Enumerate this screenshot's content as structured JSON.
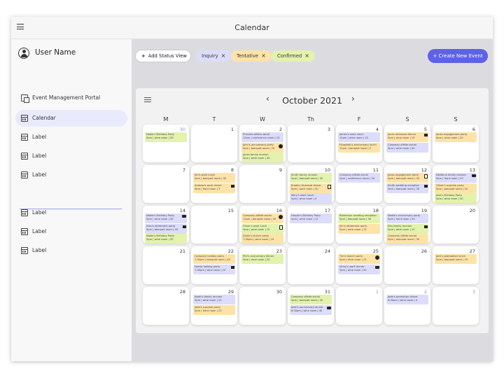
{
  "app": {
    "title": "Calendar"
  },
  "sidebar": {
    "user_name": "User Name",
    "items": [
      {
        "label": "Event Management Portal",
        "icon": "portal-icon"
      },
      {
        "label": "Calendar",
        "icon": "calendar-icon",
        "active": true
      },
      {
        "label": "Label",
        "icon": "calendar-icon"
      },
      {
        "label": "Label",
        "icon": "calendar-icon"
      },
      {
        "label": "Label",
        "icon": "calendar-icon"
      },
      {
        "label": "Label",
        "icon": "calendar-icon"
      },
      {
        "label": "Label",
        "icon": "calendar-icon"
      },
      {
        "label": "Label",
        "icon": "calendar-icon"
      }
    ]
  },
  "toolbar": {
    "add_status_view": "Add Status View",
    "chips": [
      {
        "label": "Inquiry",
        "color": "#dcdcfb"
      },
      {
        "label": "Tentative",
        "color": "#fde3a7"
      },
      {
        "label": "Confirmed",
        "color": "#e3f2ad"
      }
    ],
    "create_event": "Create New Event",
    "accent": "#5e62e8"
  },
  "calendar": {
    "month_label": "October 2021",
    "prev": "‹",
    "next": "›",
    "weekdays": [
      "M",
      "T",
      "W",
      "Th",
      "F",
      "S",
      "S"
    ],
    "weeks": [
      [
        {
          "day": "30",
          "muted": true,
          "events": [
            {
              "t": "Nadia's Birthday Party",
              "d": "5pm | wine room | 30",
              "s": "confirmed"
            }
          ]
        },
        {
          "day": "1",
          "events": []
        },
        {
          "day": "2",
          "events": [
            {
              "t": "Princeto offsite social",
              "d": "12pm | conference room | 15",
              "s": "inquiry"
            },
            {
              "t": "John's anniversary party",
              "d": "5pm | banquet room | 20",
              "s": "tentative",
              "badge": "dollar"
            },
            {
              "t": "Jones family reunion",
              "d": "5pm | wine room | 40",
              "s": "confirmed"
            }
          ]
        },
        {
          "day": "3",
          "events": []
        },
        {
          "day": "4",
          "events": [
            {
              "t": "James's work lunch",
              "d": "12pm | wine room | 15",
              "s": "inquiry"
            },
            {
              "t": "Elizabeth's anniversary lunch",
              "d": "12pm | banquet room | 2",
              "s": "tentative"
            }
          ]
        },
        {
          "day": "5",
          "events": [
            {
              "t": "Jones rehearsal dinner",
              "d": "5pm | wine room | 15",
              "s": "tentative",
              "badge": "flag"
            },
            {
              "t": "Company offsite social",
              "d": "5pm | wine room | 30",
              "s": "inquiry"
            }
          ]
        },
        {
          "day": "6",
          "events": [
            {
              "t": "Jones engagement party",
              "d": "5pm | wine room | 20",
              "s": "tentative"
            }
          ]
        }
      ],
      [
        {
          "day": "7",
          "events": []
        },
        {
          "day": "8",
          "events": [
            {
              "t": "Jim's work lunch",
              "d": "5pm | banquet room | 30",
              "s": "tentative"
            },
            {
              "t": "Andrew's work dinner",
              "d": "5pm | front room | 3",
              "s": "tentative",
              "badge": "flag"
            }
          ]
        },
        {
          "day": "9",
          "events": []
        },
        {
          "day": "10",
          "events": [
            {
              "t": "Smith family reunion",
              "d": "5pm | banquet room | 30",
              "s": "confirmed"
            },
            {
              "t": "Brooks rehearsal dinner",
              "d": "5pm | back room | 30",
              "s": "tentative",
              "badge": "note"
            },
            {
              "t": "Mary's work lunch",
              "d": "5pm | wine room | 4",
              "s": "inquiry"
            }
          ]
        },
        {
          "day": "11",
          "events": [
            {
              "t": "Company offsite social",
              "d": "5pm | conference room | 30",
              "s": "inquiry"
            }
          ]
        },
        {
          "day": "12",
          "events": [
            {
              "t": "Jones engagement party",
              "d": "5pm | banquet room | 30",
              "s": "tentative",
              "badge": "note"
            },
            {
              "t": "Smith wedding reception",
              "d": "5pm | banquet room | 30",
              "s": "inquiry",
              "badge": "flag"
            }
          ]
        },
        {
          "day": "13",
          "events": [
            {
              "t": "DeMarco family reunion",
              "d": "5pm | front room | 20",
              "s": "inquiry",
              "badge": "chat"
            },
            {
              "t": "Oliver's surprise party",
              "d": "5pm | banquet room | 20",
              "s": "tentative"
            },
            {
              "t": "Jose's Birthday Party",
              "d": "5pm | wine room | 30",
              "s": "confirmed"
            }
          ]
        }
      ],
      [
        {
          "day": "14",
          "events": [
            {
              "t": "Nadia's Birthday Party",
              "d": "5pm | wine room | 30",
              "s": "inquiry",
              "badge": "chat"
            },
            {
              "t": "Alex's retirement party",
              "d": "5pm | banquet room | 40",
              "s": "inquiry",
              "badge": "flag"
            },
            {
              "t": "Nadia's Birthday Party",
              "d": "5pm | wine room | 30",
              "s": "confirmed"
            }
          ]
        },
        {
          "day": "15",
          "events": []
        },
        {
          "day": "16",
          "events": [
            {
              "t": "Company offsite social",
              "d": "12pm | banquet room | 30",
              "s": "tentative",
              "badge": "dollar"
            },
            {
              "t": "Oliver's work lunch",
              "d": "5pm | wine room | 15",
              "s": "confirmed",
              "badge": "note"
            },
            {
              "t": "Dylan's launch party",
              "d": "7:30pm | wine room | 25",
              "s": "tentative"
            }
          ]
        },
        {
          "day": "17",
          "events": [
            {
              "t": "Harper's Birthday Party",
              "d": "5pm | wine room | 12",
              "s": "inquiry"
            }
          ]
        },
        {
          "day": "18",
          "events": [
            {
              "t": "Robertson wedding reception",
              "d": "5pm | banquet room | 30",
              "s": "confirmed"
            },
            {
              "t": "Jim's retirement party",
              "d": "5pm | wine room | 15",
              "s": "tentative"
            }
          ]
        },
        {
          "day": "19",
          "events": [
            {
              "t": "Nadia's anniversary party",
              "d": "5pm | front room | 35",
              "s": "inquiry"
            },
            {
              "t": "Ellis family reunion",
              "d": "5pm | wine room | 15",
              "s": "confirmed",
              "badge": "flag"
            },
            {
              "t": "Company offsite social",
              "d": "5pm | banquet room | 30",
              "s": "tentative"
            }
          ]
        },
        {
          "day": "20",
          "events": []
        }
      ],
      [
        {
          "day": "21",
          "events": []
        },
        {
          "day": "22",
          "events": [
            {
              "t": "Company holiday party",
              "d": "7:30pm | banquet room | 45",
              "s": "tentative"
            },
            {
              "t": "Family holiday party",
              "d": "7:30pm | wine room | 15",
              "s": "inquiry",
              "badge": "flag"
            }
          ]
        },
        {
          "day": "23",
          "events": [
            {
              "t": "Phil's anniversary dinner",
              "d": "5pm | wine room | 20",
              "s": "confirmed"
            }
          ]
        },
        {
          "day": "24",
          "events": []
        },
        {
          "day": "25",
          "events": [
            {
              "t": "Tim's launch party",
              "d": "5pm | wine room | 15",
              "s": "tentative",
              "badge": "dollar"
            },
            {
              "t": "Vinny's work dinner",
              "d": "5pm | wine room | 30",
              "s": "inquiry",
              "badge": "chat"
            }
          ]
        },
        {
          "day": "26",
          "events": []
        },
        {
          "day": "27",
          "events": [
            {
              "t": "Jack's graduation lunch",
              "d": "5pm | banquet room | 15",
              "s": "tentative"
            }
          ]
        }
      ],
      [
        {
          "day": "28",
          "events": []
        },
        {
          "day": "29",
          "events": [
            {
              "t": "Noah's family reunion",
              "d": "5pm | wine room | 15",
              "s": "inquiry"
            },
            {
              "t": "Jade's surprise party",
              "d": "5pm | front room | 25",
              "s": "tentative"
            }
          ]
        },
        {
          "day": "30",
          "events": []
        },
        {
          "day": "31",
          "events": [
            {
              "t": "Company offsite social",
              "d": "5pm | banquet room | 30",
              "s": "confirmed"
            },
            {
              "t": "Jade's anniversary dinner",
              "d": "6:30pm | wine room | 30",
              "s": "inquiry",
              "badge": "chat"
            }
          ]
        },
        {
          "day": "1",
          "muted": true,
          "events": []
        },
        {
          "day": "2",
          "muted": true,
          "events": [
            {
              "t": "Jade's promotion dinner",
              "d": "6:30pm | wine room | 4",
              "s": "inquiry"
            }
          ]
        },
        {
          "day": "3",
          "muted": true,
          "events": []
        }
      ]
    ]
  }
}
